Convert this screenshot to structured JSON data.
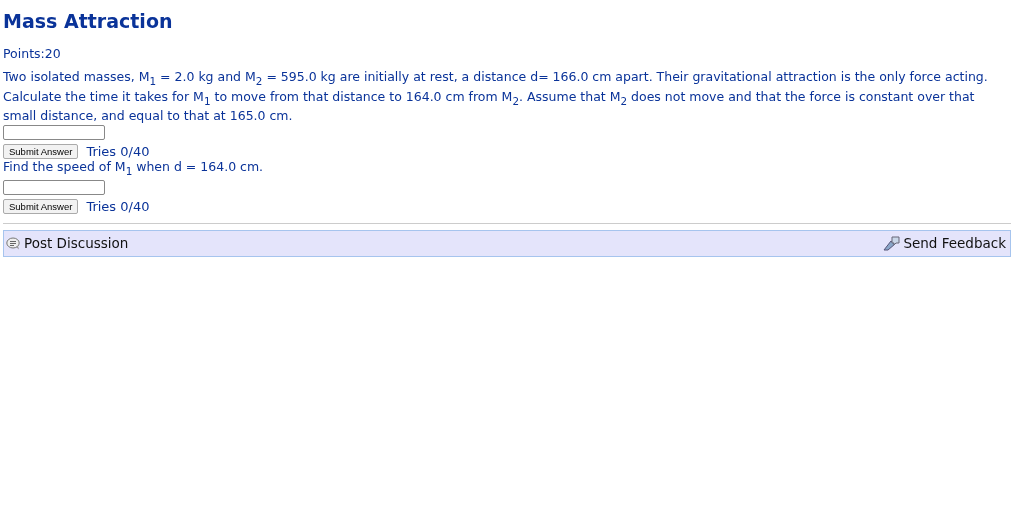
{
  "title": "Mass Attraction",
  "points": "Points:20",
  "parts": [
    {
      "prompt": "Two isolated masses, M$_{1}$ = 2.0 kg and M$_{2}$ = 595.0 kg are initially at rest, a distance d= 166.0 cm apart. Their gravitational attraction is the only force acting. Calculate the time it takes for M$_{1}$ to move from that distance to 164.0 cm from M$_{2}$. Assume that M$_{2}$ does not move and that the force is constant over that small distance, and equal to that at 165.0 cm.",
      "button": "Submit Answer",
      "tries": "Tries 0/40"
    },
    {
      "prompt": "Find the speed of M$_{1}$ when d = 164.0 cm.",
      "button": "Submit Answer",
      "tries": "Tries 0/40"
    }
  ],
  "footer": {
    "post": "Post Discussion",
    "feedback": "Send Feedback"
  }
}
